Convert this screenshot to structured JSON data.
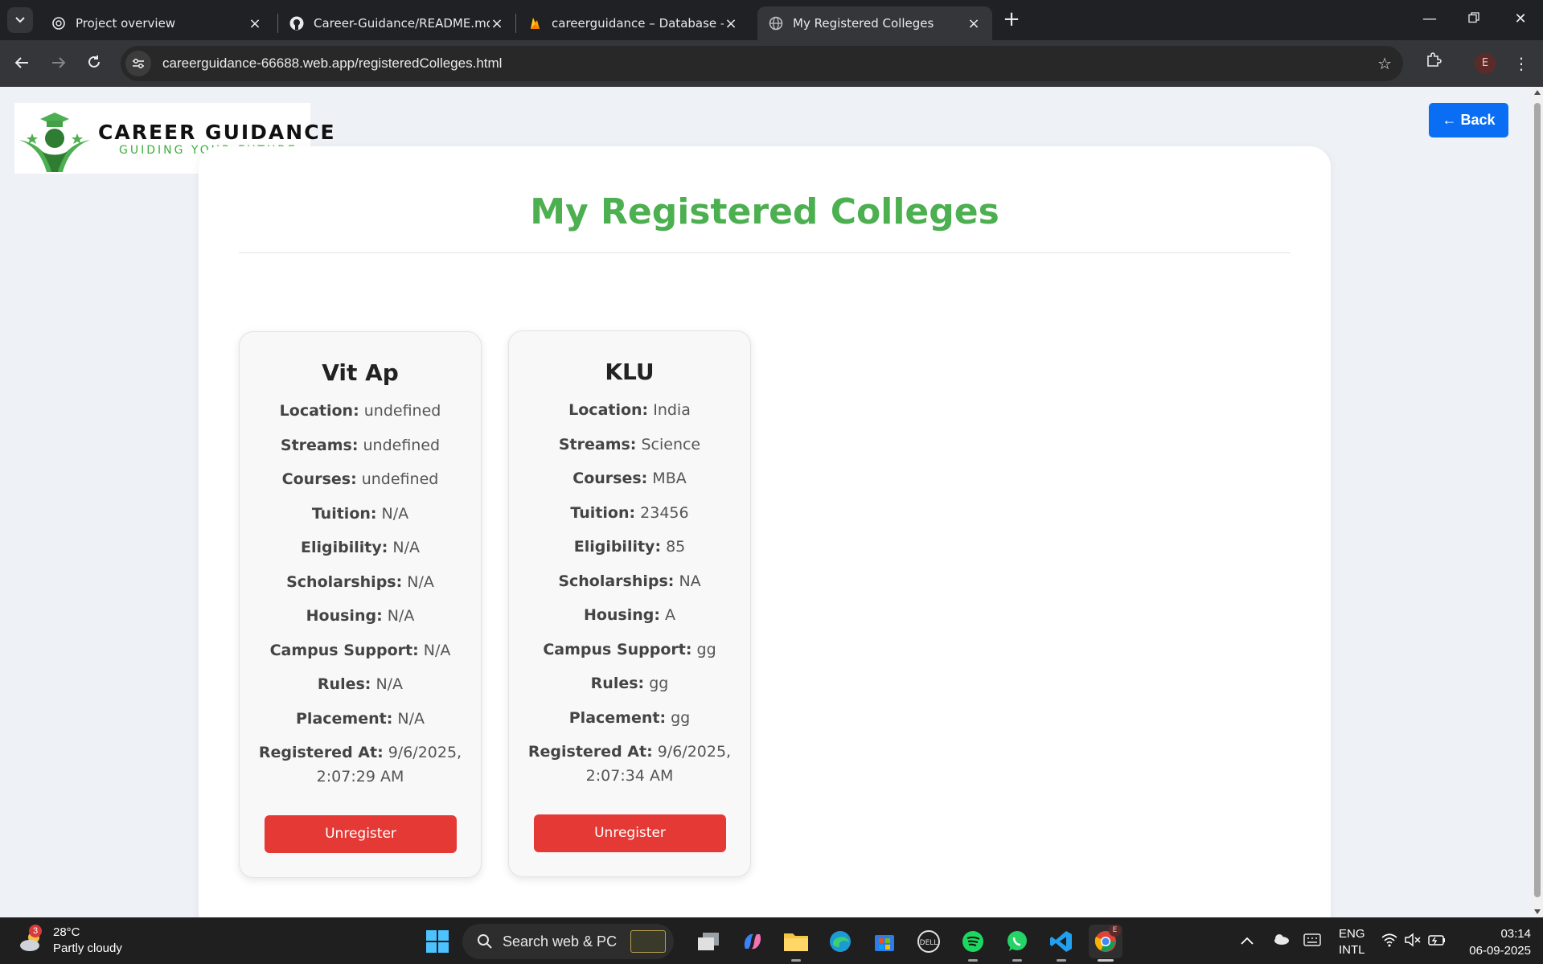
{
  "browser": {
    "tabs": [
      {
        "title": "Project overview",
        "icon": "openai-icon",
        "active": false
      },
      {
        "title": "Career-Guidance/README.md a",
        "icon": "github-icon",
        "active": false
      },
      {
        "title": "careerguidance – Database – Da",
        "icon": "firebase-icon",
        "active": false
      },
      {
        "title": "My Registered Colleges",
        "icon": "globe-icon",
        "active": true
      }
    ],
    "url_domain": "careerguidance-66688.web.app",
    "url_path": "/registeredColleges.html",
    "profile_initial": "E"
  },
  "page": {
    "logo_title": "CAREER GUIDANCE",
    "logo_subtitle": "GUIDING YOUR FUTURE",
    "back_label": "← Back",
    "title": "My Registered Colleges",
    "field_labels": {
      "location": "Location:",
      "streams": "Streams:",
      "courses": "Courses:",
      "tuition": "Tuition:",
      "eligibility": "Eligibility:",
      "scholarships": "Scholarships:",
      "housing": "Housing:",
      "campus_support": "Campus Support:",
      "rules": "Rules:",
      "placement": "Placement:",
      "registered_at": "Registered At:"
    },
    "colleges": [
      {
        "name": "Vit Ap",
        "location": "undefined",
        "streams": "undefined",
        "courses": "undefined",
        "tuition": "N/A",
        "eligibility": "N/A",
        "scholarships": "N/A",
        "housing": "N/A",
        "campus_support": "N/A",
        "rules": "N/A",
        "placement": "N/A",
        "registered_at": "9/6/2025, 2:07:29 AM",
        "button_label": "Unregister"
      },
      {
        "name": "KLU",
        "location": "India",
        "streams": "Science",
        "courses": "MBA",
        "tuition": "23456",
        "eligibility": "85",
        "scholarships": "NA",
        "housing": "A",
        "campus_support": "gg",
        "rules": "gg",
        "placement": "gg",
        "registered_at": "9/6/2025, 2:07:34 AM",
        "button_label": "Unregister"
      }
    ]
  },
  "taskbar": {
    "weather_temp": "28°C",
    "weather_desc": "Partly cloudy",
    "weather_badge": "3",
    "search_placeholder": "Search web & PC",
    "lang_top": "ENG",
    "lang_bottom": "INTL",
    "time": "03:14",
    "date": "06-09-2025",
    "chrome_badge": "E"
  },
  "colors": {
    "accent_green": "#4caf50",
    "back_blue": "#0a6ef5",
    "unregister_red": "#e53935"
  }
}
